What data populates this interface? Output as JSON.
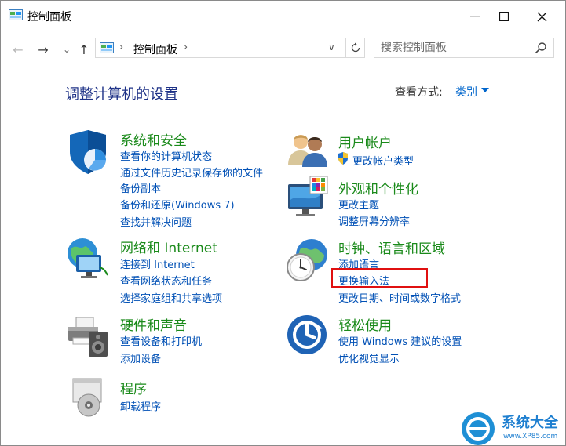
{
  "window": {
    "title": "控制面板",
    "controls": {
      "minimize": "─",
      "maximize": "☐",
      "close": "✕"
    }
  },
  "toolbar": {
    "back": "←",
    "forward": "→",
    "recent": "⌄",
    "up": "↑",
    "crumb_sep_first": "›",
    "crumb": "控制面板",
    "crumb_sep_last": "›",
    "dropdown": "∨",
    "search_placeholder": "搜索控制面板"
  },
  "main": {
    "heading": "调整计算机的设置",
    "view_by_label": "查看方式:",
    "view_by_value": "类别"
  },
  "categories": {
    "system": {
      "title": "系统和安全",
      "icon": "shield-icon",
      "links": [
        "查看你的计算机状态",
        "通过文件历史记录保存你的文件",
        "备份副本",
        "备份和还原(Windows 7)",
        "查找并解决问题"
      ]
    },
    "network": {
      "title": "网络和 Internet",
      "icon": "network-globe-icon",
      "links": [
        "连接到 Internet",
        "查看网络状态和任务",
        "选择家庭组和共享选项"
      ]
    },
    "hardware": {
      "title": "硬件和声音",
      "icon": "printer-speaker-icon",
      "links": [
        "查看设备和打印机",
        "添加设备"
      ]
    },
    "programs": {
      "title": "程序",
      "icon": "programs-disc-icon",
      "links": [
        "卸载程序"
      ]
    },
    "users": {
      "title": "用户帐户",
      "icon": "users-icon",
      "links": [
        "更改帐户类型"
      ]
    },
    "appearance": {
      "title": "外观和个性化",
      "icon": "monitor-palette-icon",
      "links": [
        "更改主题",
        "调整屏幕分辨率"
      ]
    },
    "clock": {
      "title": "时钟、语言和区域",
      "icon": "clock-globe-icon",
      "links": [
        "添加语言",
        "更换输入法",
        "更改日期、时间或数字格式"
      ]
    },
    "ease": {
      "title": "轻松使用",
      "icon": "ease-of-access-icon",
      "links": [
        "使用 Windows 建议的设置",
        "优化视觉显示"
      ]
    }
  },
  "watermark": {
    "text": "系统大全",
    "url": "www.XP85.com"
  },
  "colors": {
    "category_title": "#1a8a1a",
    "link": "#0050b5",
    "heading": "#1e3287",
    "highlight_box": "#e01010"
  }
}
